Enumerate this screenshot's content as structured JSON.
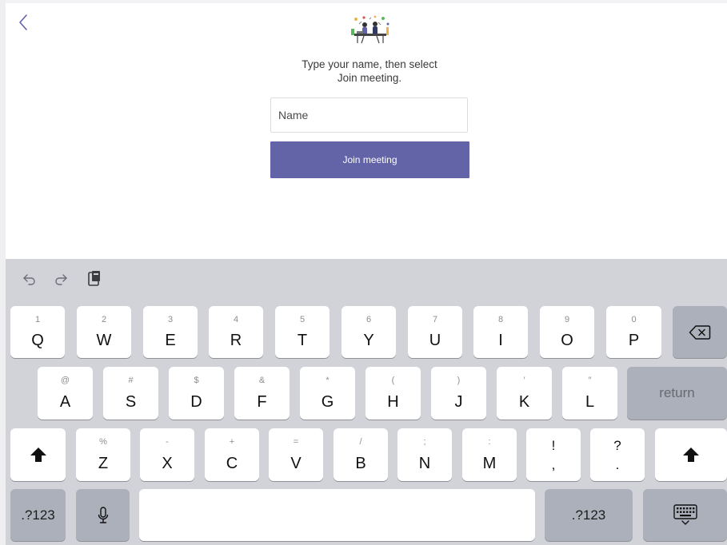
{
  "meeting": {
    "prompt_line1": "Type your name, then select",
    "prompt_line2": "Join meeting.",
    "name_placeholder": "Name",
    "join_button_label": "Join meeting"
  },
  "keyboard": {
    "row1": [
      {
        "key": "Q",
        "alt": "1"
      },
      {
        "key": "W",
        "alt": "2"
      },
      {
        "key": "E",
        "alt": "3"
      },
      {
        "key": "R",
        "alt": "4"
      },
      {
        "key": "T",
        "alt": "5"
      },
      {
        "key": "Y",
        "alt": "6"
      },
      {
        "key": "U",
        "alt": "7"
      },
      {
        "key": "I",
        "alt": "8"
      },
      {
        "key": "O",
        "alt": "9"
      },
      {
        "key": "P",
        "alt": "0"
      }
    ],
    "row2": [
      {
        "key": "A",
        "alt": "@"
      },
      {
        "key": "S",
        "alt": "#"
      },
      {
        "key": "D",
        "alt": "$"
      },
      {
        "key": "F",
        "alt": "&"
      },
      {
        "key": "G",
        "alt": "*"
      },
      {
        "key": "H",
        "alt": "("
      },
      {
        "key": "J",
        "alt": ")"
      },
      {
        "key": "K",
        "alt": "′"
      },
      {
        "key": "L",
        "alt": "″"
      }
    ],
    "row3": [
      {
        "key": "Z",
        "alt": "%"
      },
      {
        "key": "X",
        "alt": "-"
      },
      {
        "key": "C",
        "alt": "+"
      },
      {
        "key": "V",
        "alt": "="
      },
      {
        "key": "B",
        "alt": "/"
      },
      {
        "key": "N",
        "alt": ";"
      },
      {
        "key": "M",
        "alt": ":"
      }
    ],
    "exclaim_top": "!",
    "exclaim_bottom": ",",
    "question_top": "?",
    "question_bottom": ".",
    "return_label": "return",
    "numbers_label_left": ".?123",
    "numbers_label_right": ".?123"
  },
  "colors": {
    "accent": "#6264a7",
    "keyboard_bg": "#d1d3d9",
    "key_dark": "#abb0ba"
  },
  "icons": {
    "back": "chevron-left-icon",
    "undo": "undo-icon",
    "redo": "redo-icon",
    "paste": "paste-icon",
    "delete": "backspace-icon",
    "shift": "shift-icon",
    "mic": "microphone-icon",
    "hide_keyboard": "keyboard-dismiss-icon"
  }
}
